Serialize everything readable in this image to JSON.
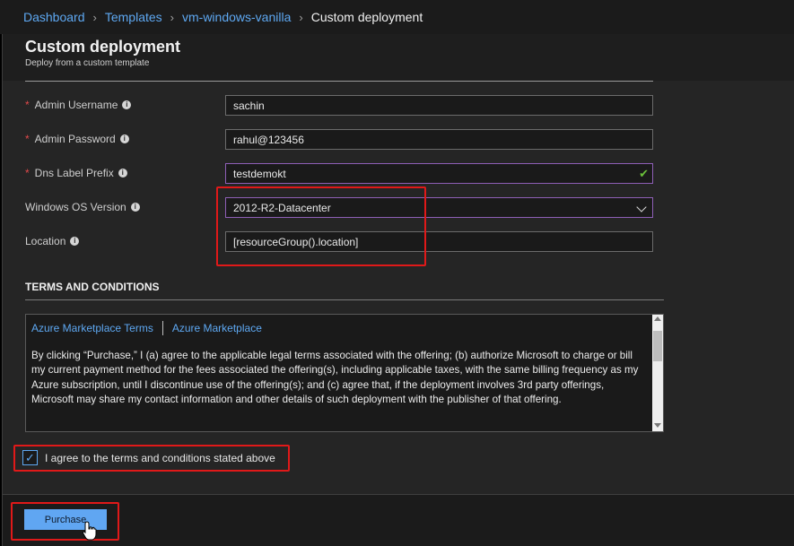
{
  "breadcrumb": {
    "items": [
      "Dashboard",
      "Templates",
      "vm-windows-vanilla"
    ],
    "current": "Custom deployment"
  },
  "page": {
    "title": "Custom deployment",
    "subtitle": "Deploy from a custom template"
  },
  "fields": {
    "admin_username": {
      "label": "Admin Username",
      "value": "sachin",
      "required": true
    },
    "admin_password": {
      "label": "Admin Password",
      "value": "rahul@123456",
      "required": true
    },
    "dns_label_prefix": {
      "label": "Dns Label Prefix",
      "value": "testdemokt",
      "required": true,
      "valid": true
    },
    "windows_os_version": {
      "label": "Windows OS Version",
      "value": "2012-R2-Datacenter"
    },
    "location": {
      "label": "Location",
      "value": "[resourceGroup().location]"
    }
  },
  "terms": {
    "heading": "TERMS AND CONDITIONS",
    "links": [
      "Azure Marketplace Terms",
      "Azure Marketplace"
    ],
    "text": "By clicking “Purchase,” I (a) agree to the applicable legal terms associated with the offering; (b) authorize Microsoft to charge or bill my current payment method for the fees associated the offering(s), including applicable taxes, with the same billing frequency as my Azure subscription, until I discontinue use of the offering(s); and (c) agree that, if the deployment involves 3rd party offerings, Microsoft may share my contact information and other details of such deployment with the publisher of that offering.",
    "agree_label": "I agree to the terms and conditions stated above",
    "agreed": true
  },
  "footer": {
    "purchase_label": "Purchase"
  },
  "colors": {
    "accent": "#5ea8f2",
    "required": "#e0494b",
    "highlight": "#e01919",
    "valid": "#6bbf3a"
  }
}
